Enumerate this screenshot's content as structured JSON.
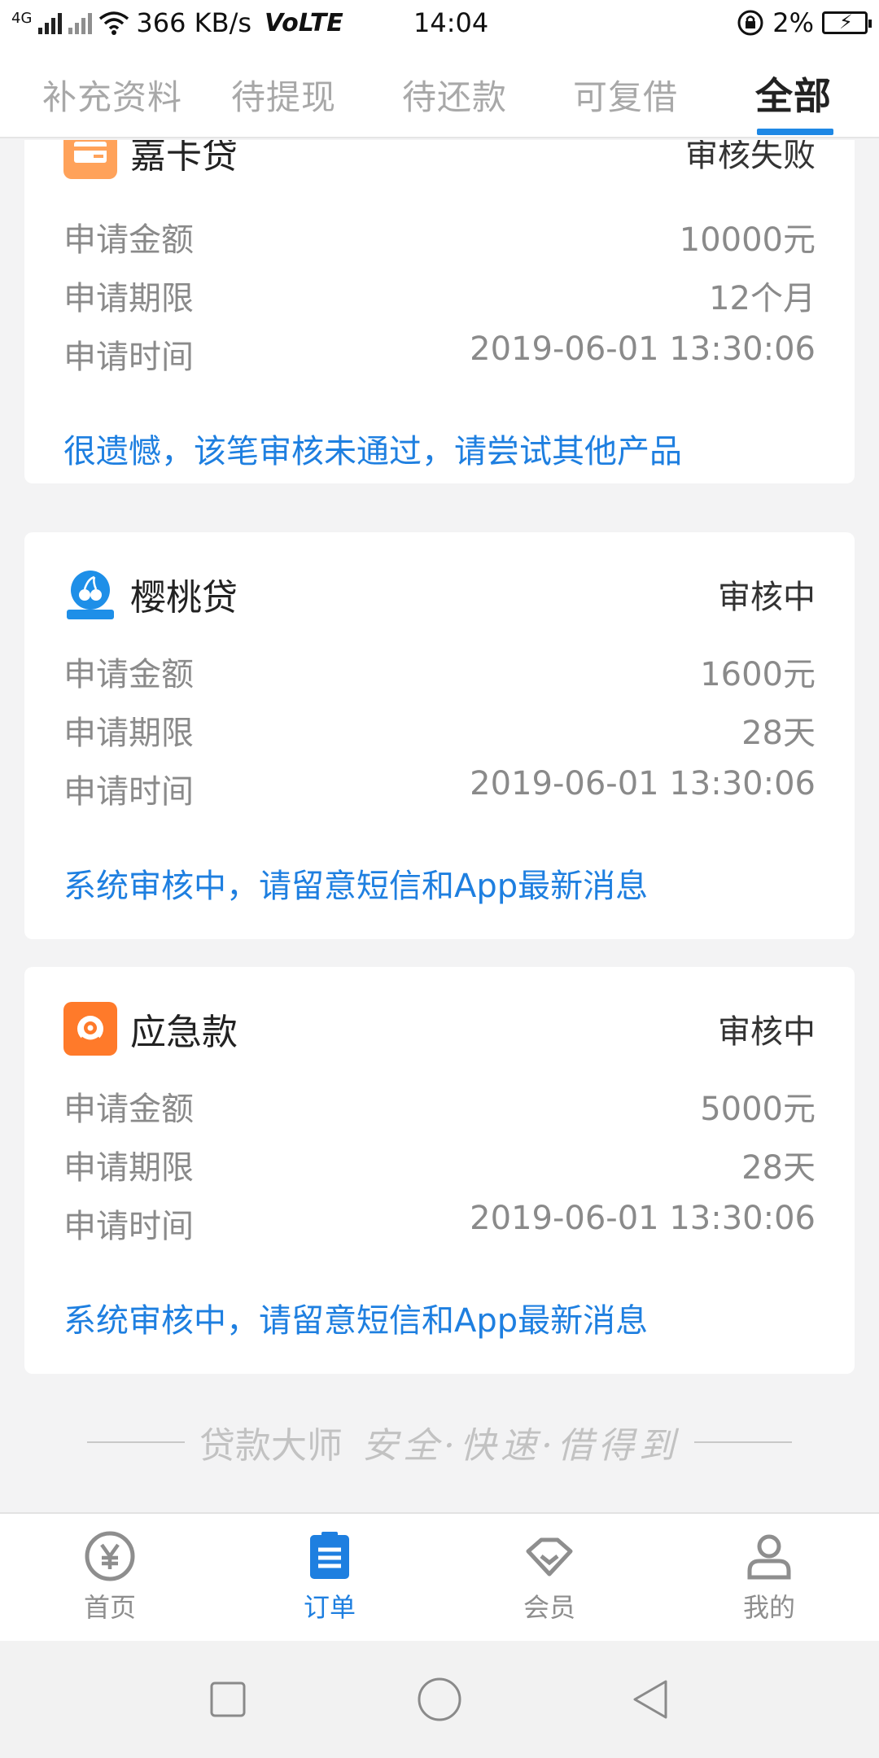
{
  "status_bar": {
    "network": "4G",
    "speed": "366 KB/s",
    "volte": "VoLTE",
    "time": "14:04",
    "battery": "2%"
  },
  "tabs": [
    {
      "label": "补充资料",
      "active": false
    },
    {
      "label": "待提现",
      "active": false
    },
    {
      "label": "待还款",
      "active": false
    },
    {
      "label": "可复借",
      "active": false
    },
    {
      "label": "全部",
      "active": true
    }
  ],
  "labels": {
    "amount": "申请金额",
    "term": "申请期限",
    "time": "申请时间"
  },
  "orders": [
    {
      "product": "嘉卡贷",
      "icon": "card-icon",
      "status": "审核失败",
      "amount": "10000元",
      "term": "12个月",
      "time": "2019-06-01 13:30:06",
      "notice": "很遗憾，该笔审核未通过，请尝试其他产品"
    },
    {
      "product": "樱桃贷",
      "icon": "cherry-icon",
      "status": "审核中",
      "amount": "1600元",
      "term": "28天",
      "time": "2019-06-01 13:30:06",
      "notice": "系统审核中，请留意短信和App最新消息"
    },
    {
      "product": "应急款",
      "icon": "sun-face-icon",
      "status": "审核中",
      "amount": "5000元",
      "term": "28天",
      "time": "2019-06-01 13:30:06",
      "notice": "系统审核中，请留意短信和App最新消息"
    }
  ],
  "footer": {
    "brand": "贷款大师",
    "slogan": "安全·快速·借得到"
  },
  "bottom_nav": [
    {
      "label": "首页",
      "icon": "yen-icon",
      "active": false
    },
    {
      "label": "订单",
      "icon": "clipboard-icon",
      "active": true
    },
    {
      "label": "会员",
      "icon": "diamond-icon",
      "active": false
    },
    {
      "label": "我的",
      "icon": "person-icon",
      "active": false
    }
  ],
  "colors": {
    "accent": "#1e7fe0",
    "tab_underline": "#1e88e5",
    "muted": "#8a8a8a"
  }
}
